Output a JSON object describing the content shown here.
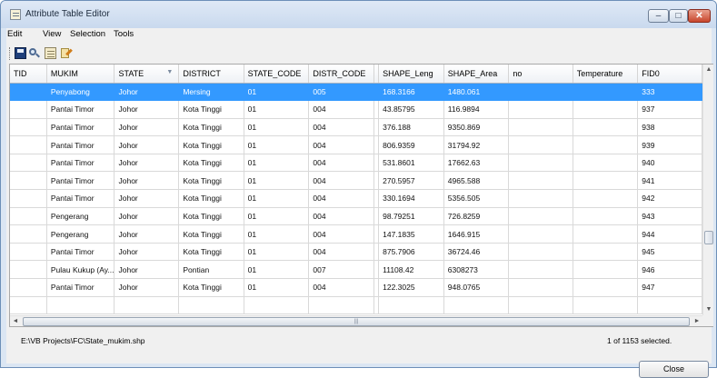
{
  "window": {
    "title": "Attribute Table Editor",
    "controls": {
      "minimize": "–",
      "maximize": "□",
      "close": "✕"
    }
  },
  "menu": [
    "Edit",
    "View",
    "Selection",
    "Tools"
  ],
  "toolbar": {
    "icons": [
      "save-icon",
      "find-icon",
      "table-icon",
      "edit-icon"
    ]
  },
  "table": {
    "columns": [
      "TID",
      "MUKIM",
      "STATE",
      "DISTRICT",
      "STATE_CODE",
      "DISTR_CODE",
      "SHAPE_Leng",
      "SHAPE_Area",
      "no",
      "Temperature",
      "FID0"
    ],
    "sorted_column": "STATE",
    "selected_row": 0,
    "rows": [
      [
        "",
        "Penyabong",
        "Johor",
        "Mersing",
        "01",
        "005",
        "168.3166",
        "1480.061",
        "",
        "",
        "333"
      ],
      [
        "",
        "Pantai Timor",
        "Johor",
        "Kota Tinggi",
        "01",
        "004",
        "43.85795",
        "116.9894",
        "",
        "",
        "937"
      ],
      [
        "",
        "Pantai Timor",
        "Johor",
        "Kota Tinggi",
        "01",
        "004",
        "376.188",
        "9350.869",
        "",
        "",
        "938"
      ],
      [
        "",
        "Pantai Timor",
        "Johor",
        "Kota Tinggi",
        "01",
        "004",
        "806.9359",
        "31794.92",
        "",
        "",
        "939"
      ],
      [
        "",
        "Pantai Timor",
        "Johor",
        "Kota Tinggi",
        "01",
        "004",
        "531.8601",
        "17662.63",
        "",
        "",
        "940"
      ],
      [
        "",
        "Pantai Timor",
        "Johor",
        "Kota Tinggi",
        "01",
        "004",
        "270.5957",
        "4965.588",
        "",
        "",
        "941"
      ],
      [
        "",
        "Pantai Timor",
        "Johor",
        "Kota Tinggi",
        "01",
        "004",
        "330.1694",
        "5356.505",
        "",
        "",
        "942"
      ],
      [
        "",
        "Pengerang",
        "Johor",
        "Kota Tinggi",
        "01",
        "004",
        "98.79251",
        "726.8259",
        "",
        "",
        "943"
      ],
      [
        "",
        "Pengerang",
        "Johor",
        "Kota Tinggi",
        "01",
        "004",
        "147.1835",
        "1646.915",
        "",
        "",
        "944"
      ],
      [
        "",
        "Pantai Timor",
        "Johor",
        "Kota Tinggi",
        "01",
        "004",
        "875.7906",
        "36724.46",
        "",
        "",
        "945"
      ],
      [
        "",
        "Pulau Kukup (Ay...",
        "Johor",
        "Pontian",
        "01",
        "007",
        "11108.42",
        "6308273",
        "",
        "",
        "946"
      ],
      [
        "",
        "Pantai Timor",
        "Johor",
        "Kota Tinggi",
        "01",
        "004",
        "122.3025",
        "948.0765",
        "",
        "",
        "947"
      ],
      [
        "",
        "",
        "",
        "",
        "",
        "",
        "",
        "",
        "",
        "",
        ""
      ]
    ],
    "vertical_scroll": {
      "up": "▲",
      "down": "▼",
      "position": 0.72,
      "visible_fraction": 0.06
    },
    "horizontal_scroll": {
      "left": "◄",
      "right": "►",
      "grip": "|||"
    }
  },
  "status": {
    "path": "E:\\VB Projects\\FC\\State_mukim.shp",
    "selection": "1 of 1153 selected."
  },
  "buttons": {
    "close": "Close"
  }
}
